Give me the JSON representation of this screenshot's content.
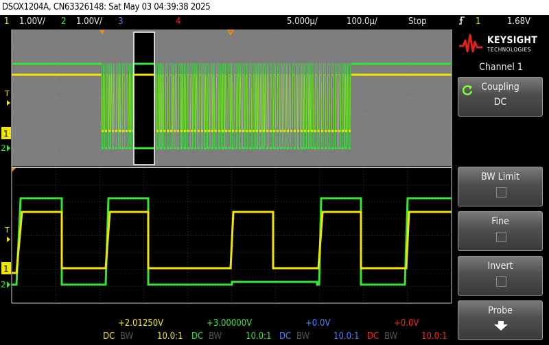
{
  "title_bar": {
    "text": "DSOX1204A, CN63326148: Sat May 03 04:39:38 2025"
  },
  "status": {
    "ch1_num": "1",
    "ch1_scale": "1.00V/",
    "ch2_num": "2",
    "ch2_scale": "1.00V/",
    "ch3_num": "3",
    "ch4_num": "4",
    "timebase": "5.000µ/",
    "delay": "100.0µ/",
    "run_state": "Stop",
    "trigger_icon": "trigger-edge-icon",
    "trig_ch": "1",
    "trig_level": "1.68V"
  },
  "panel": {
    "brand": "KEYSIGHT",
    "brand_sub": "TECHNOLOGIES",
    "title": "Channel 1",
    "keys": {
      "coupling_label": "Coupling",
      "coupling_value": "DC",
      "bw_label": "BW Limit",
      "fine_label": "Fine",
      "invert_label": "Invert",
      "probe_label": "Probe"
    }
  },
  "bottom": {
    "ch1_offset": "+2.01250V",
    "ch2_offset": "+3.00000V",
    "ch3_offset": "+0.0V",
    "ch4_offset": "+0.0V",
    "dc": "DC",
    "bw": "BW",
    "probe": "10.0:1"
  },
  "markers": {
    "trig_marker": "T",
    "ch1_marker": "1",
    "ch2_marker": "2"
  },
  "colors": {
    "ch1": "#f2e600",
    "ch2": "#36e536",
    "ch3": "#4f7fff",
    "ch4": "#ff2020",
    "trigger": "#ff8c00"
  }
}
